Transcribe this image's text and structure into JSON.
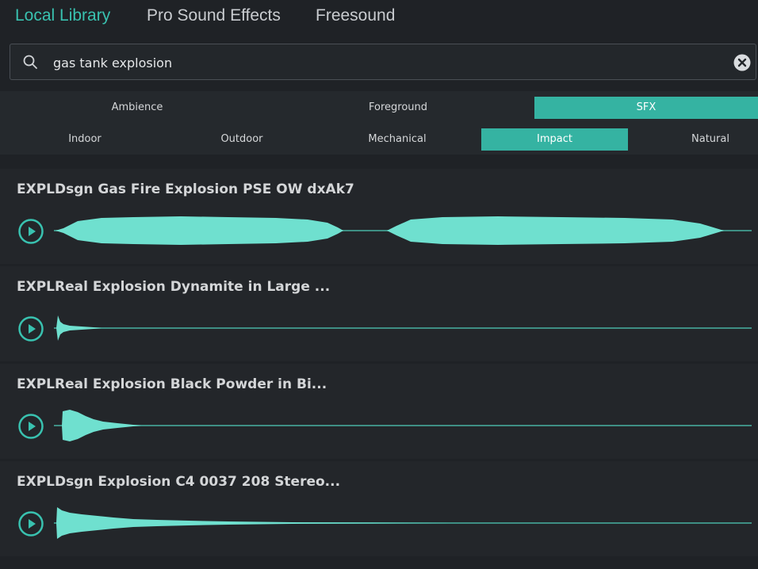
{
  "tabs": [
    {
      "label": "Local Library",
      "active": true
    },
    {
      "label": "Pro Sound Effects",
      "active": false
    },
    {
      "label": "Freesound",
      "active": false
    }
  ],
  "search": {
    "value": "gas tank explosion",
    "placeholder": ""
  },
  "filters": {
    "row1": [
      {
        "label": "Ambience",
        "selected": false
      },
      {
        "label": "Foreground",
        "selected": false
      },
      {
        "label": "SFX",
        "selected": true
      }
    ],
    "row2": [
      {
        "label": "Indoor",
        "selected": false
      },
      {
        "label": "Outdoor",
        "selected": false
      },
      {
        "label": "Mechanical",
        "selected": false
      },
      {
        "label": "Impact",
        "selected": true
      },
      {
        "label": "Natural",
        "selected": false
      }
    ]
  },
  "results": [
    {
      "title": "EXPLDsgn Gas Fire Explosion PSE OW dxAk7"
    },
    {
      "title": "EXPLReal Explosion Dynamite in Large ..."
    },
    {
      "title": "EXPLReal Explosion Black Powder in Bi..."
    },
    {
      "title": "EXPLDsgn Explosion C4 0037 208 Stereo..."
    }
  ],
  "colors": {
    "accent": "#39c2b0",
    "waveform": "#6fe0cf",
    "background": "#1f2226"
  },
  "icons": {
    "search": "search-icon",
    "clear": "clear-icon",
    "play": "play-icon"
  }
}
